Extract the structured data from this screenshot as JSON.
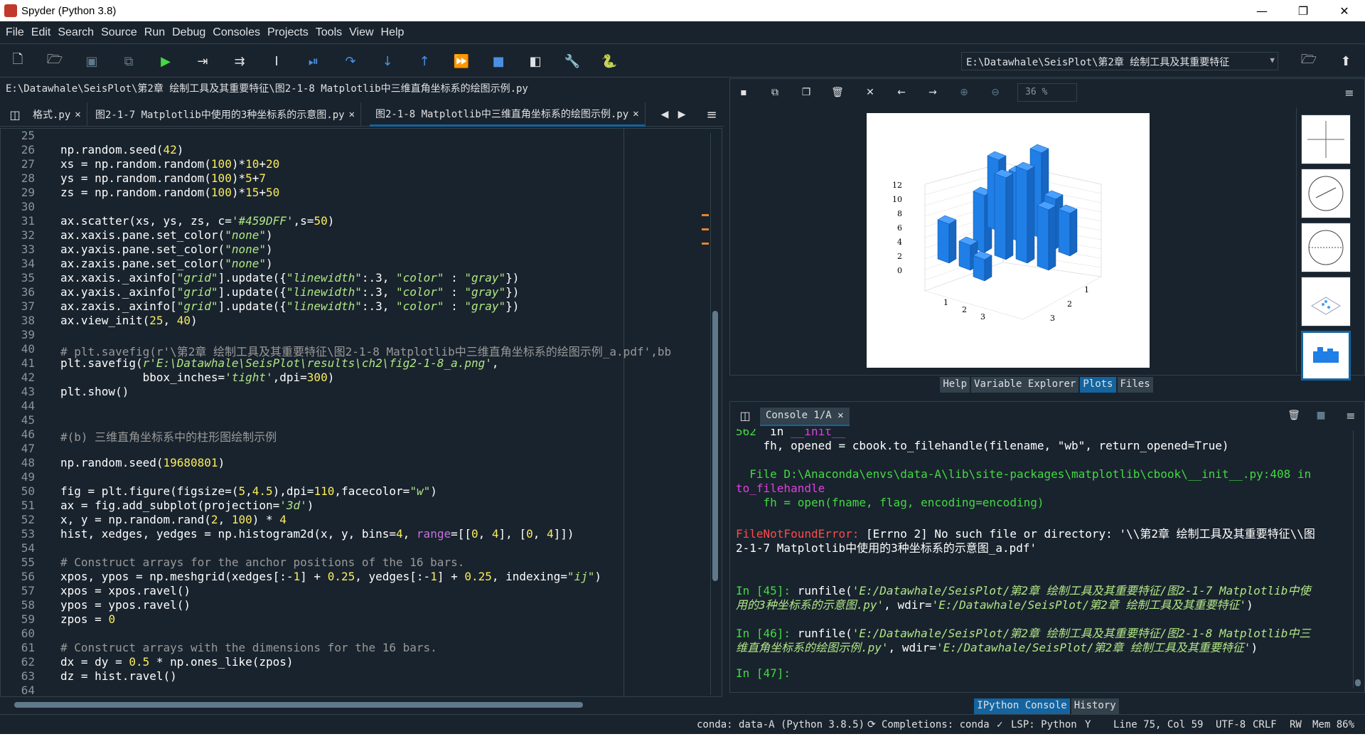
{
  "window": {
    "title": "Spyder (Python 3.8)",
    "min": "—",
    "max": "❐",
    "close": "✕"
  },
  "menu": [
    "File",
    "Edit",
    "Search",
    "Source",
    "Run",
    "Debug",
    "Consoles",
    "Projects",
    "Tools",
    "View",
    "Help"
  ],
  "working_dir": "E:\\Datawhale\\SeisPlot\\第2章 绘制工具及其重要特征",
  "editor": {
    "path": "E:\\Datawhale\\SeisPlot\\第2章 绘制工具及其重要特征\\图2-1-8 Matplotlib中三维直角坐标系的绘图示例.py",
    "tabs": [
      {
        "label": "格式.py"
      },
      {
        "label": "图2-1-7 Matplotlib中使用的3种坐标系的示意图.py"
      },
      {
        "label": "图2-1-8 Matplotlib中三维直角坐标系的绘图示例.py"
      }
    ],
    "line_numbers": [
      "25",
      "26",
      "27",
      "28",
      "29",
      "30",
      "31",
      "32",
      "33",
      "34",
      "35",
      "36",
      "37",
      "38",
      "39",
      "40",
      "41",
      "42",
      "43",
      "44",
      "45",
      "46",
      "47",
      "48",
      "49",
      "50",
      "51",
      "52",
      "53",
      "54",
      "55",
      "56",
      "57",
      "58",
      "59",
      "60",
      "61",
      "62",
      "63",
      "64"
    ]
  },
  "plots": {
    "zoom": "36 %",
    "figure": {
      "z_ticks": [
        "12",
        "10",
        "8",
        "6",
        "4",
        "2",
        "0"
      ],
      "x_ticks": [
        "1",
        "2",
        "3"
      ],
      "y_ticks": [
        "3",
        "2",
        "1"
      ],
      "bar_color": "#1f7fe6"
    },
    "pane_tabs": [
      "Help",
      "Variable Explorer",
      "Plots",
      "Files"
    ]
  },
  "console": {
    "tab_label": "Console 1/A",
    "pane_tabs": [
      "IPython Console",
      "History"
    ]
  },
  "status": {
    "conda": "conda: data-A (Python 3.8.5)",
    "completions": "Completions: conda",
    "lsp": "LSP: Python",
    "position": "Line 75, Col 59",
    "encoding": "UTF-8",
    "eol": "CRLF",
    "rw": "RW",
    "mem": "Mem 86%"
  },
  "colors": {
    "background": "#19232d",
    "accent": "#1464a0",
    "border": "#32414b"
  }
}
